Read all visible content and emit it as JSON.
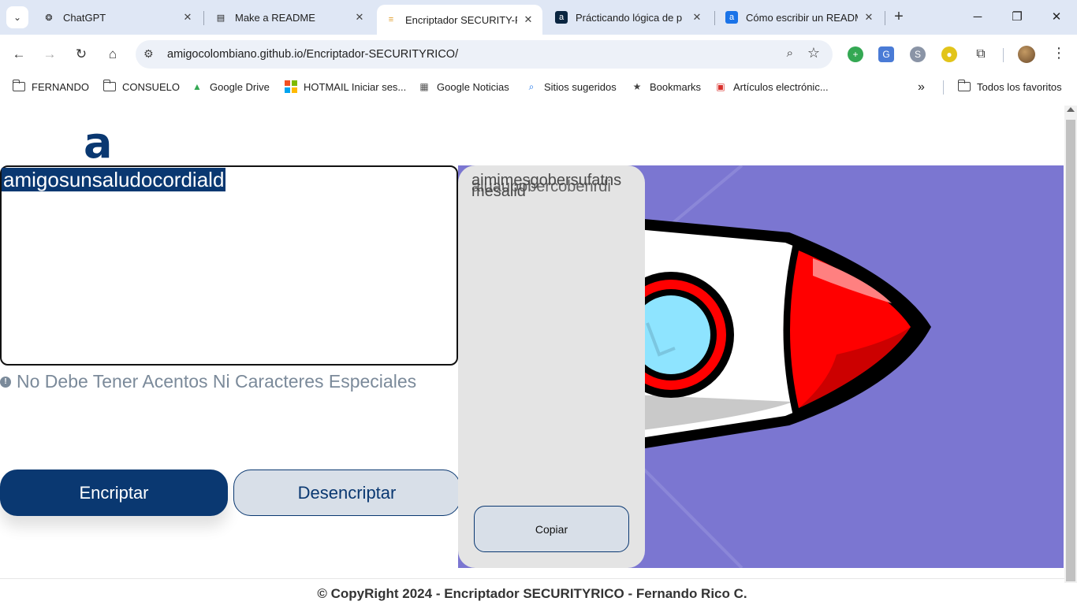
{
  "browser": {
    "tabs": [
      {
        "title": "ChatGPT",
        "icon": "chatgpt-icon"
      },
      {
        "title": "Make a README",
        "icon": "document-icon"
      },
      {
        "title": "Encriptador SECURITY-R",
        "icon": "stack-icon",
        "active": true
      },
      {
        "title": "Prácticando lógica de p",
        "icon": "alura-icon"
      },
      {
        "title": "Cómo escribir un READM",
        "icon": "alura-icon"
      }
    ],
    "url": "amigocolombiano.github.io/Encriptador-SECURITYRICO/",
    "bookmarks": [
      {
        "label": "FERNANDO",
        "icon": "folder-icon"
      },
      {
        "label": "CONSUELO",
        "icon": "folder-icon"
      },
      {
        "label": "Google Drive",
        "icon": "drive-icon"
      },
      {
        "label": "HOTMAIL Iniciar ses...",
        "icon": "microsoft-icon"
      },
      {
        "label": "Google Noticias",
        "icon": "news-icon"
      },
      {
        "label": "Sitios sugeridos",
        "icon": "search-icon"
      },
      {
        "label": "Bookmarks",
        "icon": "star-icon"
      },
      {
        "label": "Artículos electrónic...",
        "icon": "shop-icon"
      }
    ],
    "all_bookmarks": "Todos los favoritos",
    "colors": {
      "tabstrip": "#dfe7f5",
      "omnibox": "#edf1f8"
    }
  },
  "page": {
    "logo": "a",
    "input_text": "amigosunsaludocordiald",
    "warning": "No Debe Tener Acentos Ni Caracteres Especiales",
    "encrypt_label": "Encriptar",
    "decrypt_label": "Desencriptar",
    "output_line1": "aimimesgobersufatns",
    "output_line2": "mesalid",
    "output_overlap": "aluaupobercobenrdi",
    "copy_label": "Copiar",
    "footer": "© CopyRight 2024 - Encriptador SECURITYRICO - Fernando Rico C.",
    "colors": {
      "primary": "#0a3871",
      "secondary": "#d8dfe8",
      "illustration_bg": "#7b76d1",
      "rocket_red": "#ff0000"
    }
  }
}
